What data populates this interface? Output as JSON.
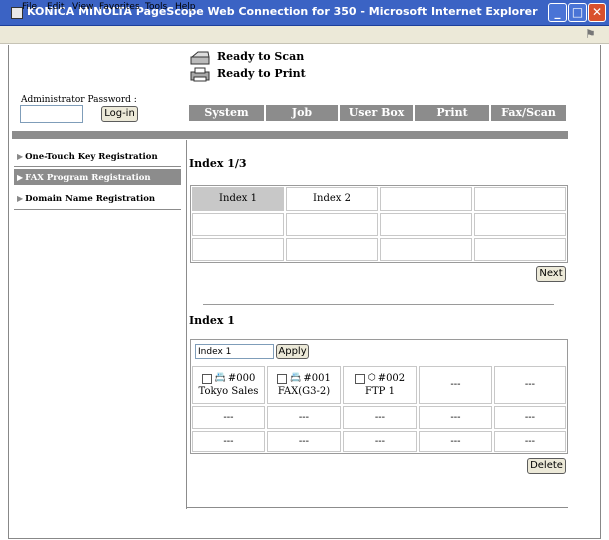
{
  "window": {
    "title": "KONICA MINOLTA PageScope Web Connection for 350 - Microsoft Internet Explorer",
    "minimize": "_",
    "maximize": "□",
    "close": "✕"
  },
  "menu": [
    "File",
    "Edit",
    "View",
    "Favorites",
    "Tools",
    "Help"
  ],
  "status": {
    "scan": "Ready to Scan",
    "print": "Ready to Print"
  },
  "admin": {
    "label": "Administrator Password :",
    "password_value": "",
    "login_button": "Log-in"
  },
  "tabs": [
    "System",
    "Job",
    "User Box",
    "Print",
    "Fax/Scan"
  ],
  "sidebar": [
    {
      "label": "One-Touch Key Registration",
      "active": false
    },
    {
      "label": "FAX Program Registration",
      "active": true
    },
    {
      "label": "Domain Name Registration",
      "active": false
    }
  ],
  "index_section": {
    "title": "Index 1/3",
    "rows": [
      [
        "Index 1",
        "Index 2",
        "",
        ""
      ],
      [
        "",
        "",
        "",
        ""
      ],
      [
        "",
        "",
        "",
        ""
      ]
    ],
    "next_button": "Next"
  },
  "program_section": {
    "title": "Index 1",
    "name_input_value": "Index 1",
    "apply_button": "Apply",
    "programs": [
      {
        "number": "#000",
        "name": "Tokyo Sales",
        "icon": "address-book-icon"
      },
      {
        "number": "#001",
        "name": "FAX(G3-2)",
        "icon": "address-book-icon"
      },
      {
        "number": "#002",
        "name": "FTP 1",
        "icon": "cube-icon"
      }
    ],
    "empty": "---",
    "delete_button": "Delete"
  }
}
